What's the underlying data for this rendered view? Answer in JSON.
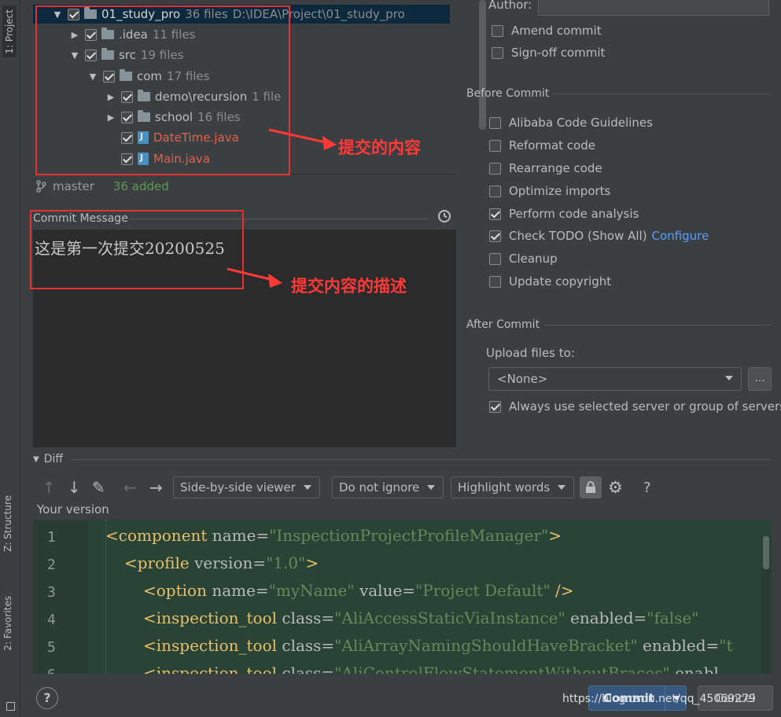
{
  "sidebar": {
    "tabs": [
      {
        "label": "1: Project"
      },
      {
        "label": "Z: Structure"
      },
      {
        "label": "2: Favorites"
      }
    ]
  },
  "tree": {
    "rows": [
      {
        "name": "01_study_pro",
        "count": "36 files",
        "path": "D:\\IDEA\\Project\\01_study_pro"
      },
      {
        "name": ".idea",
        "count": "11 files"
      },
      {
        "name": "src",
        "count": "19 files"
      },
      {
        "name": "com",
        "count": "17 files"
      },
      {
        "name": "demo\\recursion",
        "count": "1 file"
      },
      {
        "name": "school",
        "count": "16 files"
      },
      {
        "name": "DateTime.java"
      },
      {
        "name": "Main.java"
      }
    ]
  },
  "status": {
    "branch": "master",
    "added": "36 added"
  },
  "annotations": {
    "tree_note": "提交的内容",
    "message_note": "提交内容的描述"
  },
  "commit_message": {
    "label": "Commit Message",
    "value": "这是第一次提交20200525"
  },
  "right_panel": {
    "author_label": "Author:",
    "author_value": "",
    "amend": "Amend commit",
    "signoff": "Sign-off commit",
    "before_commit": "Before Commit",
    "before_items": [
      {
        "label": "Alibaba Code Guidelines",
        "checked": false
      },
      {
        "label": "Reformat code",
        "checked": false
      },
      {
        "label": "Rearrange code",
        "checked": false
      },
      {
        "label": "Optimize imports",
        "checked": false
      },
      {
        "label": "Perform code analysis",
        "checked": true
      },
      {
        "label": "Check TODO (Show All)",
        "checked": true,
        "link": "Configure"
      },
      {
        "label": "Cleanup",
        "checked": false
      },
      {
        "label": "Update copyright",
        "checked": false
      }
    ],
    "after_commit": "After Commit",
    "upload_label": "Upload files to:",
    "upload_value": "<None>",
    "dots_label": "...",
    "always_use": "Always use selected server or group of servers"
  },
  "diff": {
    "title": "Diff",
    "viewer": "Side-by-side viewer",
    "ignore": "Do not ignore",
    "highlight": "Highlight words",
    "help": "?",
    "your_version": "Your version"
  },
  "editor": {
    "line_numbers": [
      "1",
      "2",
      "3",
      "4",
      "5",
      "6"
    ],
    "lines": [
      {
        "tag": "<component",
        "parts": [
          " name=",
          "\"InspectionProjectProfileManager\"",
          ">"
        ]
      },
      {
        "tag": "<profile",
        "parts": [
          " version=",
          "\"1.0\"",
          ">"
        ]
      },
      {
        "tag": "<option",
        "parts": [
          " name=",
          "\"myName\"",
          " value=",
          "\"Project Default\"",
          " />"
        ]
      },
      {
        "tag": "<inspection_tool",
        "parts": [
          " class=",
          "\"AliAccessStaticViaInstance\"",
          " enabled=",
          "\"false\""
        ]
      },
      {
        "tag": "<inspection_tool",
        "parts": [
          " class=",
          "\"AliArrayNamingShouldHaveBracket\"",
          " enabled=",
          "\"t"
        ]
      },
      {
        "tag": "<inspection_tool",
        "parts": [
          " class=",
          "\"AliControlFlowStatementWithoutBraces\"",
          " enabl"
        ]
      }
    ]
  },
  "footer": {
    "help": "?",
    "commit": "Commit",
    "cancel": "Cancel",
    "watermark": "https://blog.csdn.net/qq_45069279"
  },
  "colors": {
    "accent": "#365880",
    "annotation": "#ff3838",
    "link": "#589df6",
    "modified_file": "#e0624c",
    "added_text": "#629755"
  }
}
